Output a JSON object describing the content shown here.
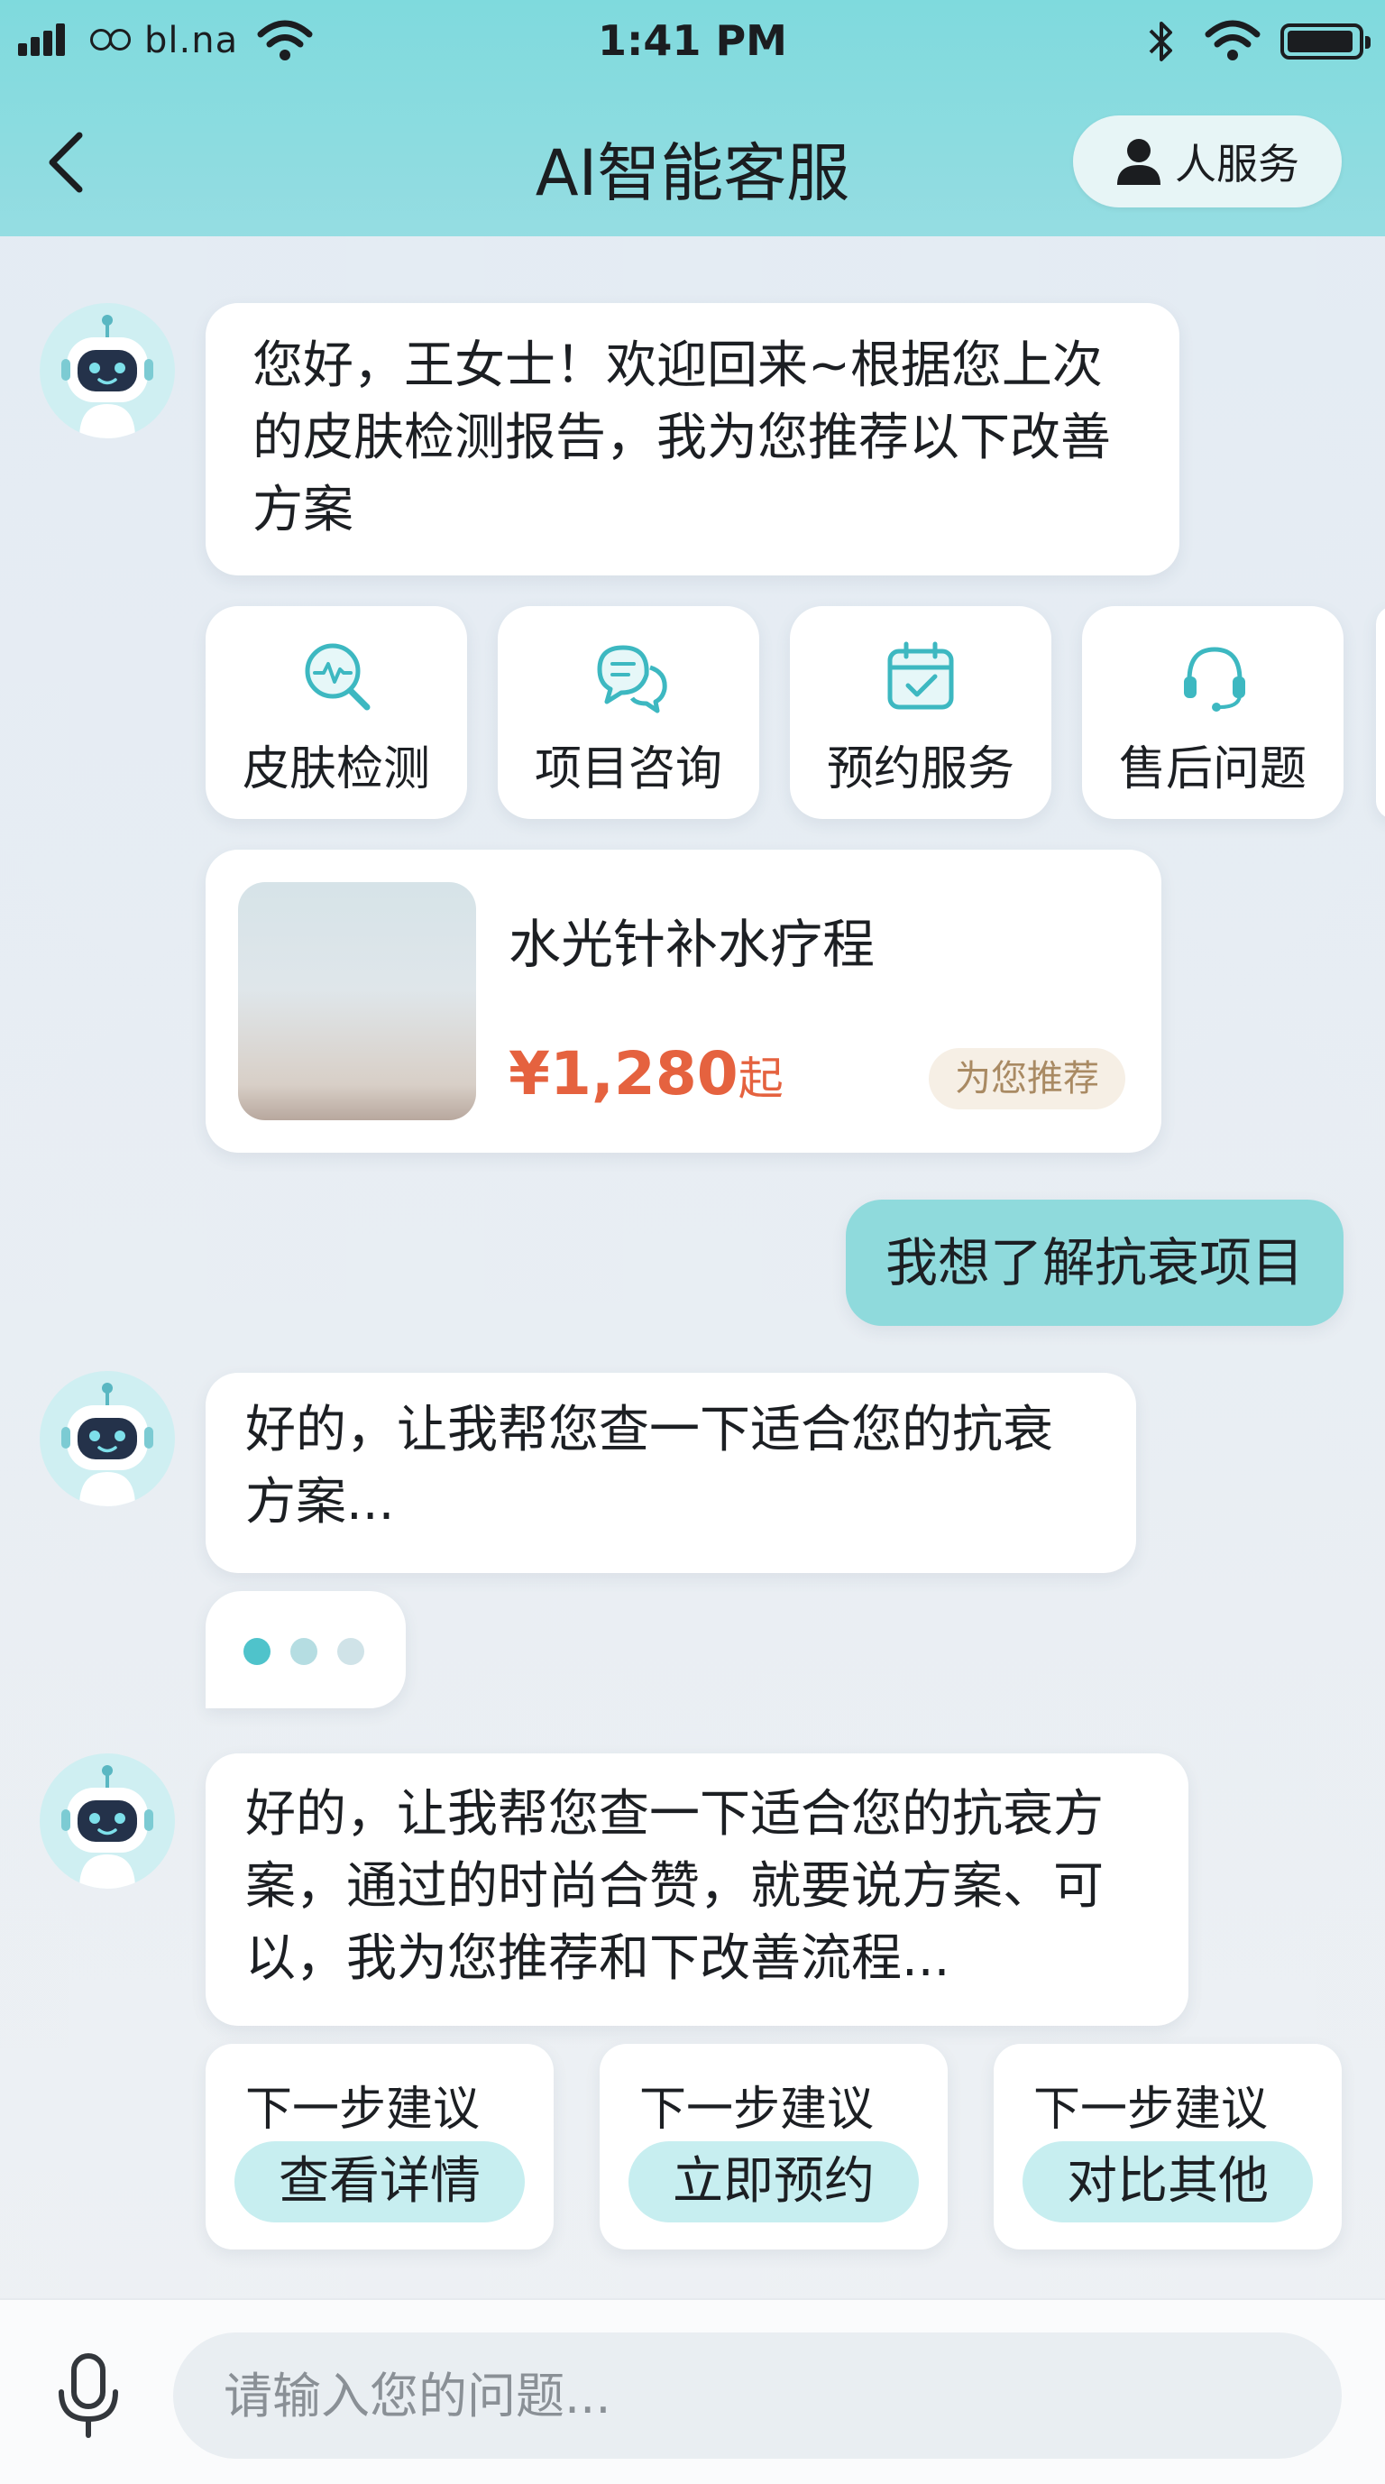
{
  "status_bar": {
    "carrier": "bl.na",
    "time": "1:41 PM",
    "battery_level": 0.95
  },
  "header": {
    "title": "AI智能客服",
    "human_service_label": "人服务"
  },
  "messages": {
    "greeting": "您好，王女士！欢迎回来~根据您上次的皮肤检测报告，我为您推荐以下改善方案",
    "user_query": "我想了解抗衰项目",
    "reply_1": "好的，让我帮您查一下适合您的抗衰方案...",
    "reply_2": "好的，让我帮您查一下适合您的抗衰方案，通过的时尚合赞，就要说方案、可以，我为您推荐和下改善流程..."
  },
  "quick_actions": [
    {
      "label": "皮肤检测",
      "icon": "skin-scan-icon"
    },
    {
      "label": "项目咨询",
      "icon": "chat-bubbles-icon"
    },
    {
      "label": "预约服务",
      "icon": "calendar-check-icon"
    },
    {
      "label": "售后问题",
      "icon": "headset-icon"
    }
  ],
  "product": {
    "name": "水光针补水疗程",
    "currency": "¥",
    "price": "1,280",
    "price_suffix": "起",
    "badge": "为您推荐"
  },
  "suggestions": [
    {
      "title": "下一步建议",
      "action": "查看详情"
    },
    {
      "title": "下一步建议",
      "action": "立即预约"
    },
    {
      "title": "下一步建议",
      "action": "对比其他"
    }
  ],
  "composer": {
    "placeholder": "请输入您的问题..."
  },
  "colors": {
    "header_bg": "#8adbe0",
    "accent": "#4fc3cb",
    "user_bubble": "#8fdadc",
    "price": "#e5623f",
    "badge_bg": "#f6efe5",
    "badge_text": "#a98a63"
  }
}
